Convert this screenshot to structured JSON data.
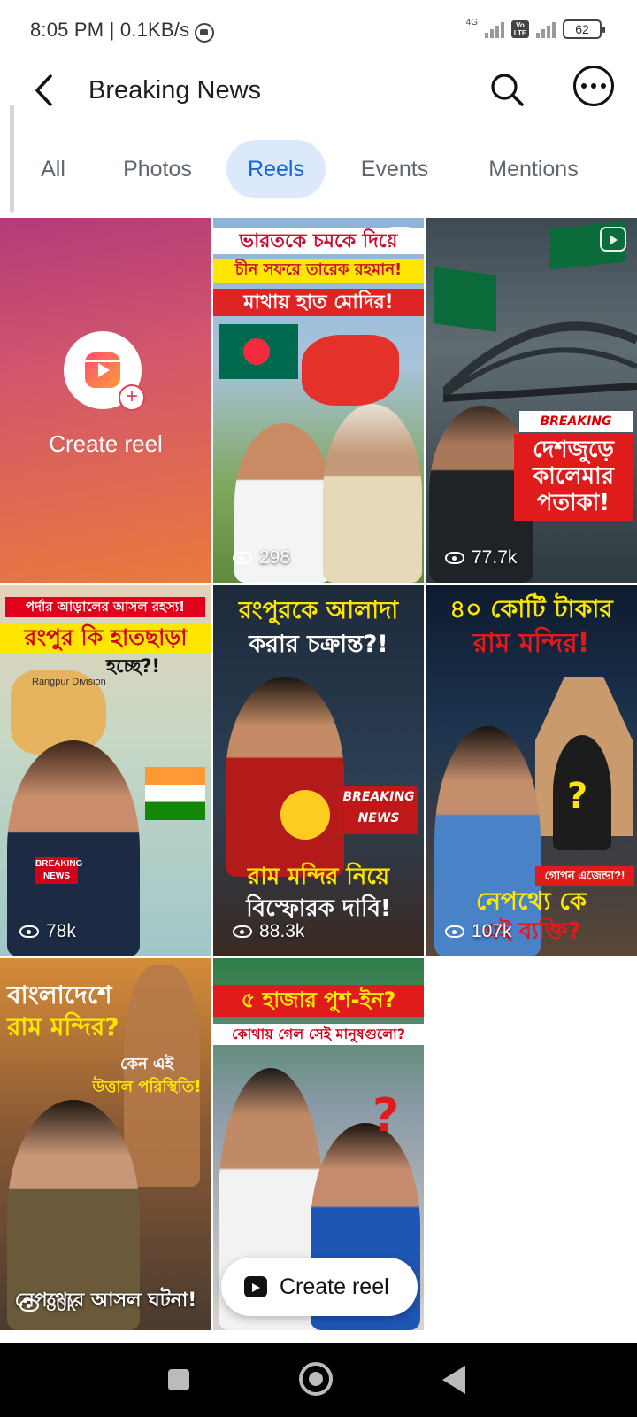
{
  "status_bar": {
    "time": "8:05 PM | 0.1KB/s",
    "network_type": "4G",
    "volte": "Vo LTE",
    "battery": "62"
  },
  "header": {
    "title": "Breaking News"
  },
  "tabs": [
    {
      "label": "All",
      "active": false
    },
    {
      "label": "Photos",
      "active": false
    },
    {
      "label": "Reels",
      "active": true
    },
    {
      "label": "Events",
      "active": false
    },
    {
      "label": "Mentions",
      "active": false
    }
  ],
  "create_tile": {
    "label": "Create reel"
  },
  "reels": [
    {
      "views": "298",
      "headline_lines": [
        "ভারতকে চমকে দিয়ে",
        "চীন সফরে তারেক রহমান!",
        "মাথায় হাত মোদির!"
      ]
    },
    {
      "views": "77.7k",
      "badge": "BREAKING NEWS",
      "headline_lines": [
        "দেশজুড়ে",
        "কালেমার",
        "পতাকা!"
      ]
    },
    {
      "views": "78k",
      "headline_lines": [
        "পর্দার আড়ালের আসল রহস্য!",
        "রংপুর কি হাতছাড়া",
        "হচ্ছে?!"
      ],
      "map_label": "Rangpur Division",
      "mic_label": "BREAKING NEWS"
    },
    {
      "views": "88.3k",
      "headline_lines": [
        "রংপুরকে আলাদা",
        "করার চক্রান্ত?!"
      ],
      "badge": "BREAKING NEWS",
      "bottom_lines": [
        "রাম মন্দির নিয়ে",
        "বিস্ফোরক দাবি!"
      ]
    },
    {
      "views": "107k",
      "headline_lines": [
        "৪০ কোটি টাকার",
        "রাম মন্দির!"
      ],
      "tag": "গোপন এজেন্ডা?!",
      "bottom_lines": [
        "নেপথ্যে কে",
        "এই ব্যক্তি?"
      ]
    },
    {
      "views": "80k",
      "headline_lines": [
        "বাংলাদেশে",
        "রাম মন্দির?"
      ],
      "sub_lines": [
        "কেন এই",
        "উত্তাল পরিস্থিতি!"
      ],
      "bottom_lines": [
        "নেপথ্যের আসল ঘটনা!"
      ]
    },
    {
      "views": "",
      "headline_lines": [
        "৫ হাজার পুশ-ইন?",
        "কোথায় গেল সেই মানুষগুলো?"
      ]
    }
  ],
  "floating_button": {
    "label": "Create reel"
  },
  "colors": {
    "accent": "#1466d6",
    "active_tab_bg": "#dbe9fb",
    "headline_red": "#e02424",
    "headline_yellow": "#ffe600"
  }
}
